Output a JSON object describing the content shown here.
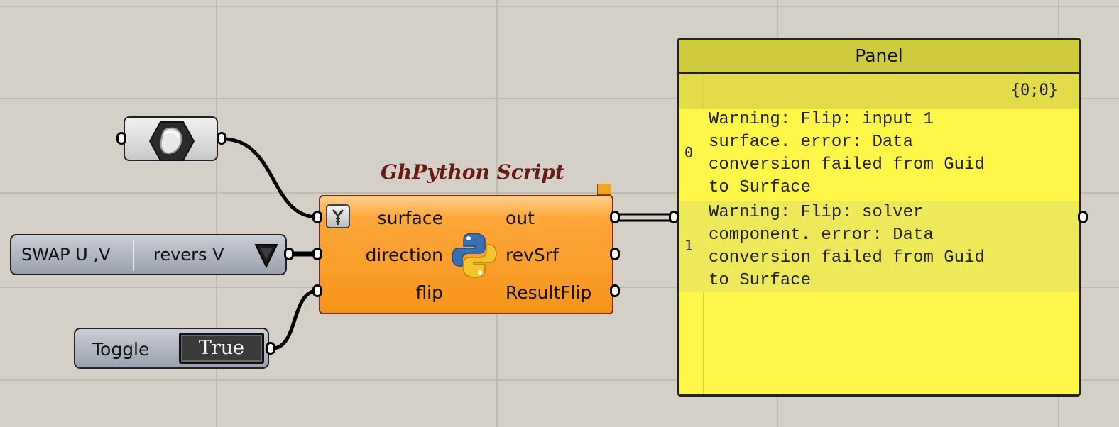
{
  "canvas": {
    "background": "#d4d0c8",
    "grid_color": "#bfbbb3"
  },
  "geometry_param": {
    "icon": "geometry-hexagon-icon"
  },
  "value_list": {
    "item_a": "SWAP U ,V",
    "item_b": "revers V",
    "dropdown_icon": "triangle-down-icon"
  },
  "toggle": {
    "label": "Toggle",
    "value": "True"
  },
  "ghpython": {
    "title": "GhPython Script",
    "icon": "python-logo-icon",
    "inputs": [
      "surface",
      "direction",
      "flip"
    ],
    "outputs": [
      "out",
      "revSrf",
      "ResultFlip"
    ],
    "color": "#f5941a"
  },
  "panel": {
    "title": "Panel",
    "path": "{0;0}",
    "rows": [
      {
        "index": "0",
        "text": "Warning: Flip: input 1\nsurface. error: Data\nconversion failed from Guid\nto Surface"
      },
      {
        "index": "1",
        "text": "Warning: Flip: solver\ncomponent. error: Data\nconversion failed from Guid\nto Surface"
      }
    ],
    "color": "#fff64a"
  }
}
